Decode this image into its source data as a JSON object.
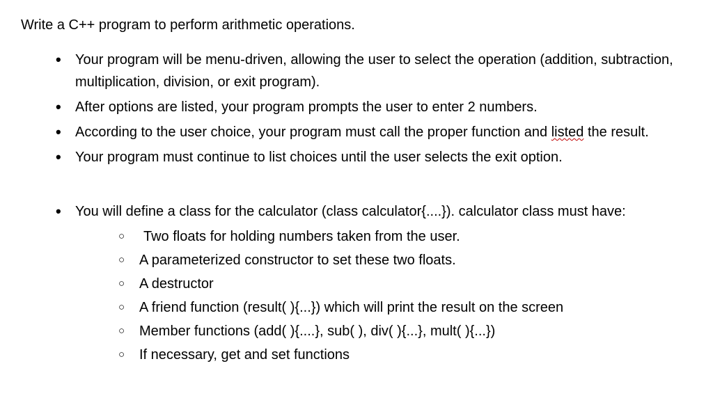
{
  "title": "Write a C++ program to perform arithmetic operations.",
  "bullets1": [
    "Your program will be menu-driven, allowing the user to select the operation (addition, subtraction, multiplication, division, or exit program).",
    "After options are listed, your program prompts the user to enter 2 numbers.",
    null,
    "Your program must continue to list choices until the user selects the exit option."
  ],
  "bullet1_3_prefix": "According to the user choice, your program must call the proper function and ",
  "bullet1_3_wavy": "listed",
  "bullet1_3_suffix": " the result.",
  "bullets2_intro": "You will define a class for the calculator (class calculator{....}). calculator class must have:",
  "sub_bullets": [
    "Two floats for holding numbers taken from the user.",
    "A parameterized constructor to set these two floats.",
    "A destructor",
    "A friend function (result( ){...}) which will print the result on the screen",
    "Member functions (add( ){....}, sub( ), div( ){...}, mult( ){...})",
    "If necessary, get and set functions"
  ]
}
